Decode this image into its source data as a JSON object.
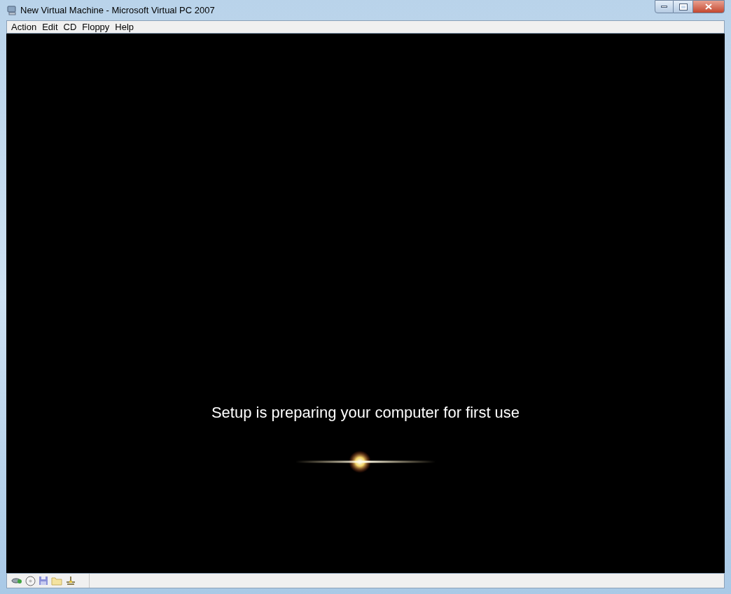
{
  "window": {
    "title": "New Virtual Machine - Microsoft Virtual PC 2007"
  },
  "menu": [
    "Action",
    "Edit",
    "CD",
    "Floppy",
    "Help"
  ],
  "screen": {
    "message": "Setup is preparing your computer for first use"
  }
}
